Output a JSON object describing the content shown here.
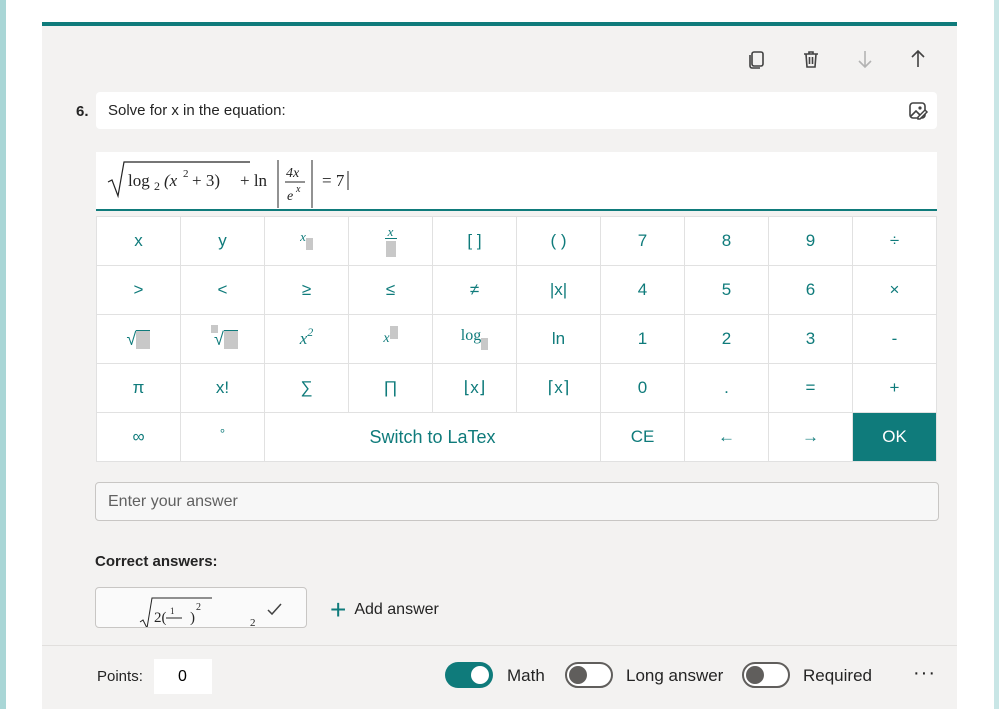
{
  "question": {
    "number": "6.",
    "text": "Solve for x in the equation:"
  },
  "equation": {
    "sqrt_log": "log",
    "sqrt_log_base": "2",
    "sqrt_arg": "(x",
    "sqrt_arg_exp": "2",
    "sqrt_arg_rest": "+ 3)",
    "plus_ln": "+ ln",
    "frac_num": "4x",
    "frac_den_base": "e",
    "frac_den_exp": "x",
    "equals": "= 7"
  },
  "keypad": {
    "rows": [
      [
        "x",
        "y",
        "x_sub",
        "x_frac",
        "[ ]",
        "( )",
        "7",
        "8",
        "9",
        "÷"
      ],
      [
        ">",
        "<",
        "≥",
        "≤",
        "≠",
        "|x|",
        "4",
        "5",
        "6",
        "×"
      ],
      [
        "sqrt",
        "nthroot",
        "x2",
        "xpow",
        "log",
        "ln",
        "1",
        "2",
        "3",
        "-"
      ],
      [
        "π",
        "x!",
        "∑",
        "∏",
        "⌊x⌋",
        "⌈x⌉",
        "0",
        ".",
        "=",
        "+"
      ]
    ],
    "labels": {
      "x": "x",
      "y": "y",
      "brackets": "[ ]",
      "parens": "( )",
      "divide": "÷",
      "gt": ">",
      "lt": "<",
      "ge": "≥",
      "le": "≤",
      "ne": "≠",
      "abs": "|x|",
      "times": "×",
      "x_sym": "x",
      "x2_base": "x",
      "x2_exp": "2",
      "log": "log",
      "ln": "ln",
      "minus": "-",
      "pi": "π",
      "fact": "x!",
      "sum": "∑",
      "prod": "∏",
      "floor": "⌊x⌋",
      "ceil": "⌈x⌉",
      "dot": ".",
      "eq": "=",
      "plus": "+",
      "n0": "0",
      "n1": "1",
      "n2": "2",
      "n3": "3",
      "n4": "4",
      "n5": "5",
      "n6": "6",
      "n7": "7",
      "n8": "8",
      "n9": "9",
      "infinity": "∞",
      "degree": "°",
      "switch_latex": "Switch to LaTex",
      "ce": "CE",
      "left_arrow": "←",
      "right_arrow": "→",
      "ok": "OK"
    }
  },
  "answer": {
    "placeholder": "Enter your answer"
  },
  "correct_answers": {
    "label": "Correct answers:",
    "add_label": "Add answer"
  },
  "footer": {
    "points_label": "Points:",
    "points_value": "0",
    "math_label": "Math",
    "long_answer_label": "Long answer",
    "required_label": "Required",
    "more": "···"
  },
  "colors": {
    "accent": "#0f7b7b",
    "card_bg": "#f3f2f1"
  },
  "icons": {
    "toolbar": [
      "copy-icon",
      "trash-icon",
      "arrow-down-icon",
      "arrow-up-icon"
    ],
    "question": "image-edit-icon"
  }
}
